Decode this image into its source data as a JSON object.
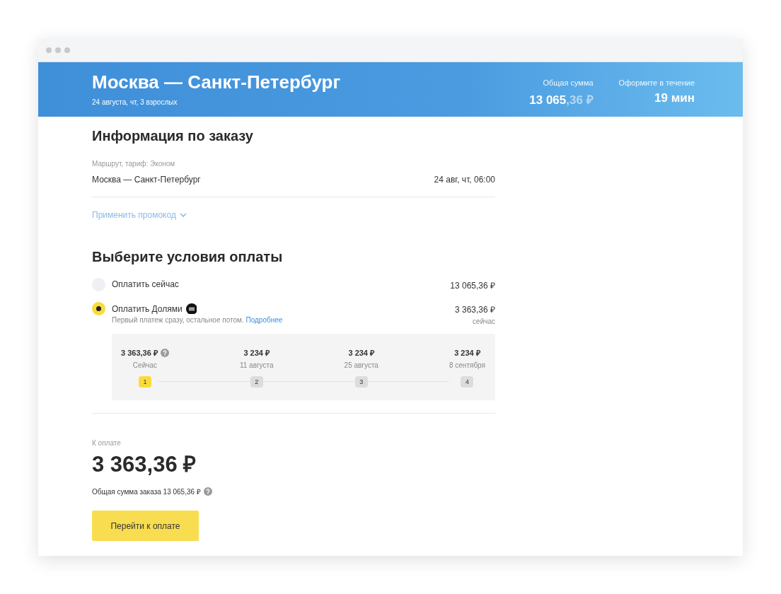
{
  "header": {
    "title": "Москва — Санкт-Петербург",
    "subtitle": "24 августа, чт, 3 взрослых",
    "stats": [
      {
        "label": "Общая сумма",
        "value": "13 065",
        "value_faded": ",36 ₽"
      },
      {
        "label": "Оформите в течение",
        "value": "19 мин"
      }
    ]
  },
  "order_info": {
    "title": "Информация по заказу",
    "caption": "Маршрут, тариф: Эконом",
    "route": "Москва — Санкт-Петербург",
    "datetime": "24 авг, чт, 06:00",
    "promo_link": "Применить промокод",
    "promo_expanded": false
  },
  "payment": {
    "title": "Выберите условия оплаты",
    "options": [
      {
        "label": "Оплатить сейчас",
        "amount": "13 065,36 ₽",
        "selected": false
      },
      {
        "label": "Оплатить Долями",
        "amount": "3 363,36 ₽",
        "amount_note": "сейчас",
        "note": "Первый платеж сразу, остальное потом.",
        "note_link": "Подробнее",
        "selected": true
      }
    ],
    "schedule": [
      {
        "amount": "3 363,36 ₽",
        "date": "Сейчас",
        "step": "1",
        "selected": true,
        "help": true
      },
      {
        "amount": "3 234 ₽",
        "date": "11 августа",
        "step": "2",
        "selected": false
      },
      {
        "amount": "3 234 ₽",
        "date": "25 августа",
        "step": "3",
        "selected": false
      },
      {
        "amount": "3 234 ₽",
        "date": "8 сентября",
        "step": "4",
        "selected": false
      }
    ]
  },
  "summary": {
    "label": "К оплате",
    "amount": "3 363,36 ₽",
    "total": "Общая сумма заказа 13 065,36 ₽",
    "button": "Перейти к оплате"
  }
}
